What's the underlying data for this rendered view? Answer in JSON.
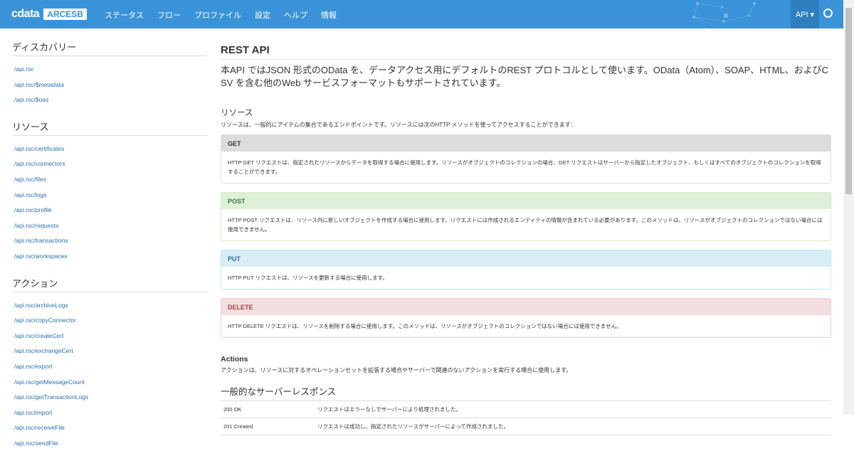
{
  "nav": {
    "logo": "cdata",
    "product": "ARCESB",
    "items": [
      "ステータス",
      "フロー",
      "プロファイル",
      "設定",
      "ヘルプ",
      "情報"
    ],
    "api": "API ▾"
  },
  "sidebar": {
    "sections": [
      {
        "title": "ディスカバリー",
        "links": [
          "/api.rsc",
          "/api.rsc/$metadata",
          "/api.rsc/$oas"
        ]
      },
      {
        "title": "リソース",
        "links": [
          "/api.rsc/certificates",
          "/api.rsc/connectors",
          "/api.rsc/files",
          "/api.rsc/logs",
          "/api.rsc/profile",
          "/api.rsc/requests",
          "/api.rsc/transactions",
          "/api.rsc/workspaces"
        ]
      },
      {
        "title": "アクション",
        "links": [
          "/api.rsc/archiveLogs",
          "/api.rsc/copyConnector",
          "/api.rsc/createCert",
          "/api.rsc/exchangeCert",
          "/api.rsc/export",
          "/api.rsc/getMessageCount",
          "/api.rsc/getTransactionLogs",
          "/api.rsc/import",
          "/api.rsc/receiveFile",
          "/api.rsc/sendFile"
        ]
      }
    ]
  },
  "main": {
    "title": "REST API",
    "lead": "本API ではJSON 形式のOData を、データアクセス用にデフォルトのREST プロトコルとして使います。OData（Atom）、SOAP、HTML、およびCSV を含む他のWeb サービスフォーマットもサポートされています。",
    "resources_title": "リソース",
    "resources_desc": "リソースは、一般的にアイテムの集合であるエンドポイントです。リソースには次のHTTP メソッドを使ってアクセスすることができます：",
    "methods": [
      {
        "name": "GET",
        "desc": "HTTP GET リクエストは、指定されたリソースからデータを取得する場合に使用します。リソースがオブジェクトのコレクションの場合、GET リクエストはサーバーから指定したオブジェクト、もしくはすべてのオブジェクトのコレクションを取得することができます。"
      },
      {
        "name": "POST",
        "desc": "HTTP POST リクエストは、リソース内に新しいオブジェクトを作成する場合に使用します。リクエストには作成されるエンティティの情報が含まれている必要があります。このメソッドは、リソースがオブジェクトのコレクションではない場合には使用できません。"
      },
      {
        "name": "PUT",
        "desc": "HTTP PUT リクエストは、リソースを更新する場合に使用します。"
      },
      {
        "name": "DELETE",
        "desc": "HTTP DELETE リクエストは、リソースを削除する場合に使用します。このメソッドは、リソースがオブジェクトのコレクションではない場合には使用できません。"
      }
    ],
    "actions_title": "Actions",
    "actions_desc": "アクションは、リソースに対するオペレーションセットを拡張する場合やサーバーで関連のないアクションを実行する場合に使用します。",
    "responses_title": "一般的なサーバーレスポンス",
    "responses": [
      {
        "code": "200 OK",
        "desc": "リクエストはエラーなしでサーバーにより処理されました。"
      },
      {
        "code": "201 Created",
        "desc": "リクエストは成功し、指定されたリソースがサーバーによって作成されました。"
      }
    ]
  },
  "colors": {
    "navbar": "#3a93d8",
    "link": "#2a6fb0"
  }
}
